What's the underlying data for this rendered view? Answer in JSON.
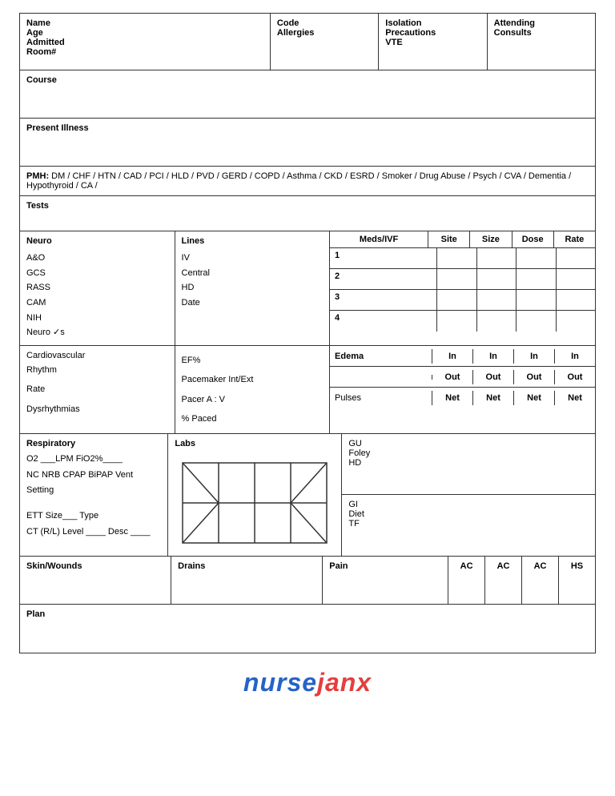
{
  "header": {
    "name_label": "Name",
    "age_label": "Age",
    "admitted_label": "Admitted",
    "room_label": "Room#",
    "code_label": "Code",
    "allergies_label": "Allergies",
    "isolation_label": "Isolation",
    "precautions_label": "Precautions",
    "vte_label": "VTE",
    "attending_label": "Attending",
    "consults_label": "Consults"
  },
  "course": {
    "label": "Course"
  },
  "present_illness": {
    "label": "Present Illness"
  },
  "pmh": {
    "prefix": "PMH:",
    "items": "DM / CHF / HTN / CAD / PCI / HLD / PVD / GERD / COPD / Asthma / CKD / ESRD / Smoker / Drug Abuse / Psych / CVA / Dementia / Hypothyroid / CA /"
  },
  "tests": {
    "label": "Tests"
  },
  "neuro": {
    "label": "Neuro",
    "items": [
      "A&O",
      "GCS",
      "RASS",
      "CAM",
      "NIH",
      "Neuro ✓s"
    ]
  },
  "lines": {
    "label": "Lines",
    "items": [
      "IV",
      "Central",
      "HD",
      "Date"
    ]
  },
  "meds": {
    "label": "Meds/IVF",
    "site_label": "Site",
    "size_label": "Size",
    "dose_label": "Dose",
    "rate_label": "Rate",
    "rows": [
      {
        "num": "1"
      },
      {
        "num": "2"
      },
      {
        "num": "3"
      },
      {
        "num": "4"
      }
    ]
  },
  "cardiovascular": {
    "label": "Cardiovascular",
    "items": [
      "Rhythm",
      "Rate",
      "Dysrhythmias"
    ]
  },
  "ef": {
    "items": [
      "EF%",
      "Pacemaker Int/Ext",
      "Pacer  A : V",
      "% Paced"
    ]
  },
  "edema": {
    "header_label": "Edema",
    "pulses_label": "Pulses",
    "cols": [
      "In",
      "In",
      "In",
      "In"
    ],
    "rows": [
      {
        "label": "",
        "values": [
          "In",
          "In",
          "In",
          "In"
        ]
      },
      {
        "label": "",
        "values": [
          "Out",
          "Out",
          "Out",
          "Out"
        ]
      },
      {
        "label": "Pulses",
        "values": [
          "Net",
          "Net",
          "Net",
          "Net"
        ]
      }
    ]
  },
  "respiratory": {
    "label": "Respiratory",
    "items": [
      "O2 ___LPM  FiO2%____",
      "NC  NRB  CPAP  BiPAP  Vent",
      "Setting",
      "",
      "ETT Size___  Type",
      "CT (R/L)  Level ____  Desc ____"
    ]
  },
  "labs": {
    "label": "Labs"
  },
  "gu": {
    "top_items": [
      "GU",
      "Foley",
      "HD"
    ],
    "bottom_items": [
      "GI",
      "Diet",
      "TF"
    ]
  },
  "skin": {
    "label": "Skin/Wounds"
  },
  "drains": {
    "label": "Drains"
  },
  "pain": {
    "label": "Pain"
  },
  "achs": {
    "values": [
      "AC",
      "AC",
      "AC",
      "HS"
    ]
  },
  "plan": {
    "label": "Plan"
  },
  "footer": {
    "brand_part1": "nurse",
    "brand_part2": "janx"
  }
}
